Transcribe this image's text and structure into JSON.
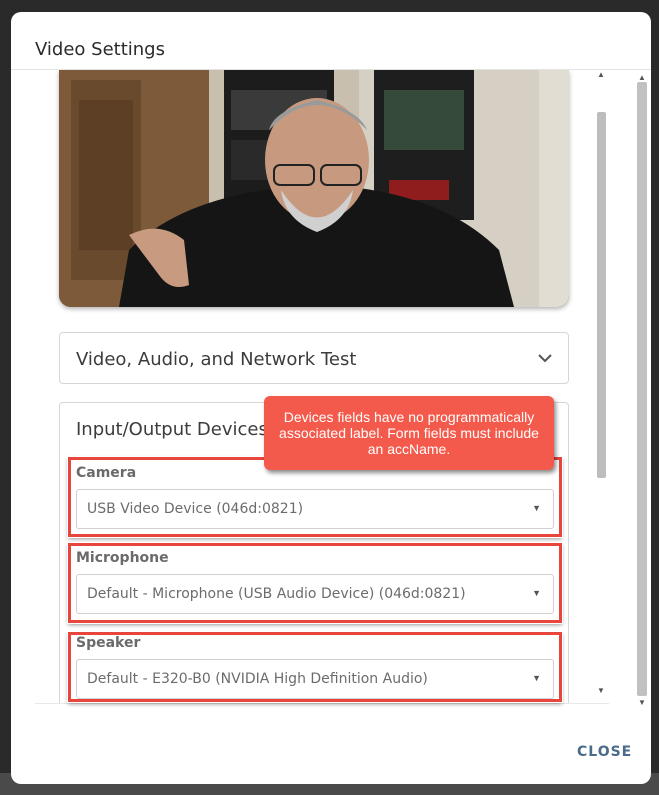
{
  "dialog": {
    "title": "Video Settings",
    "close_label": "CLOSE"
  },
  "accordion": {
    "label": "Video, Audio, and Network Test"
  },
  "io_panel": {
    "title": "Input/Output Devices",
    "fields": [
      {
        "label": "Camera",
        "value": "USB Video Device (046d:0821)"
      },
      {
        "label": "Microphone",
        "value": "Default - Microphone (USB Audio Device) (046d:0821)"
      },
      {
        "label": "Speaker",
        "value": "Default - E320-B0 (NVIDIA High Definition Audio)"
      }
    ]
  },
  "annotation": {
    "text": "Devices fields have no programmatically associated label. Form fields must include an accName."
  },
  "colors": {
    "highlight": "#e8453c",
    "callout": "#f45a4b",
    "close": "#4a6b8a"
  }
}
